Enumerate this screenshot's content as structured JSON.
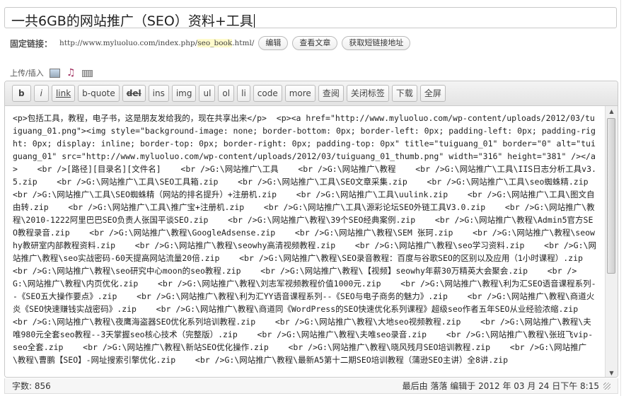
{
  "post": {
    "title": "一共6GB的网站推广（SEO）资料+工具"
  },
  "permalink": {
    "label": "固定链接：",
    "url_prefix": "http://www.myluoluo.com/index.php/",
    "slug": "seo_book",
    "url_suffix": ".html/",
    "buttons": [
      "编辑",
      "查看文章",
      "获取短链接地址"
    ]
  },
  "upload": {
    "label": "上传/插入",
    "icons": [
      "image-icon",
      "music-icon",
      "media-icon"
    ]
  },
  "toolbar": {
    "buttons": [
      "b",
      "i",
      "link",
      "b-quote",
      "del",
      "ins",
      "img",
      "ul",
      "ol",
      "li",
      "code",
      "more",
      "查阅",
      "关闭标签",
      "下载",
      "全屏"
    ]
  },
  "editor": {
    "content": "<p>包括工具，教程，电子书，这是朋友发给我的，现在共享出来</p>  <p><a href=\"http://www.myluoluo.com/wp-content/uploads/2012/03/tuiguang_01.png\"><img style=\"background-image: none; border-bottom: 0px; border-left: 0px; padding-left: 0px; padding-right: 0px; display: inline; border-top: 0px; border-right: 0px; padding-top: 0px\" title=\"tuiguang_01\" border=\"0\" alt=\"tuiguang_01\" src=\"http://www.myluoluo.com/wp-content/uploads/2012/03/tuiguang_01_thumb.png\" width=\"316\" height=\"381\" /></a>    <br />[路径][目录名][文件名]    <br />G:\\网站推广\\工具    <br />G:\\网站推广\\教程    <br />G:\\网站推广\\工具\\IIS日志分析工具v3.5.zip    <br />G:\\网站推广\\工具\\SEO工具箱.zip    <br />G:\\网站推广\\工具\\SEO文章采集.zip    <br />G:\\网站推广\\工具\\seo蜘蛛精.zip    <br />G:\\网站推广\\工具\\SEO蜘蛛精（网站的排名提升）+注册机.zip    <br />G:\\网站推广\\工具\\uulink.zip    <br />G:\\网站推广\\工具\\图文自由转.zip    <br />G:\\网站推广\\工具\\推广宝+注册机.zip    <br />G:\\网站推广\\工具\\源彩论坛SEO外链工具V3.0.zip    <br />G:\\网站推广\\教程\\2010-1222阿里巴巴SEO负责人张国平谈SEO.zip    <br />G:\\网站推广\\教程\\39个SEO经典案例.zip    <br />G:\\网站推广\\教程\\Admin5官方SEO教程录音.zip    <br />G:\\网站推广\\教程\\GoogleAdsense.zip    <br />G:\\网站推广\\教程\\SEM 张珂.zip    <br />G:\\网站推广\\教程\\seowhy教研室内部教程资料.zip    <br />G:\\网站推广\\教程\\seowhy高清视频教程.zip    <br />G:\\网站推广\\教程\\seo学习资料.zip    <br />G:\\网站推广\\教程\\seo实战密码-60天提高网站流量20倍.zip    <br />G:\\网站推广\\教程\\SEO录音教程：百度与谷歌SEO的区别以及应用（1小时课程）.zip    <br />G:\\网站推广\\教程\\seo研究中心moon的seo教程.zip    <br />G:\\网站推广\\教程\\【视频】seowhy年薪30万精英大会聚会.zip    <br />G:\\网站推广\\教程\\内页优化.zip    <br />G:\\网站推广\\教程\\刘志军视频教程价值1000元.zip    <br />G:\\网站推广\\教程\\利为汇SEO语音课程系列--《SEO五大操作要点》.zip    <br />G:\\网站推广\\教程\\利为汇YY语音课程系列--《SEO与电子商务的魅力》.zip    <br />G:\\网站推广\\教程\\商道火炎《SEO快速赚钱实战密码》.zip    <br />G:\\网站推广\\教程\\商道同《WordPress的SEO快速优化系列课程》超级seo作者五年SEO从业经验浓缩.zip    <br />G:\\网站推广\\教程\\夜鹰海盗器SEO优化系列培训教程.zip    <br />G:\\网站推广\\教程\\大地seo视频教程.zip    <br />G:\\网站推广\\教程\\夫唯980元全套seo教程--3天掌握seo核心技术（完整版）.zip    <br />G:\\网站推广\\教程\\夫唯seo录音.zip    <br />G:\\网站推广\\教程\\张班飞vip-seo全套.zip    <br />G:\\网站推广\\教程\\新站SEO优化操作.zip    <br />G:\\网站推广\\教程\\晓风残月SEO培训教程.zip    <br />G:\\网站推广\\教程\\曹鹏【SEO】-网址搜索引擎优化.zip    <br />G:\\网站推广\\教程\\最新A5第十二期SEO培训教程（蒲逊SEO主讲）全8讲.zip"
  },
  "status": {
    "word_count": "字数: 856",
    "last_edit": "最后由 落落 编辑于 2012 年 03 月 24 日下午 8:15"
  }
}
